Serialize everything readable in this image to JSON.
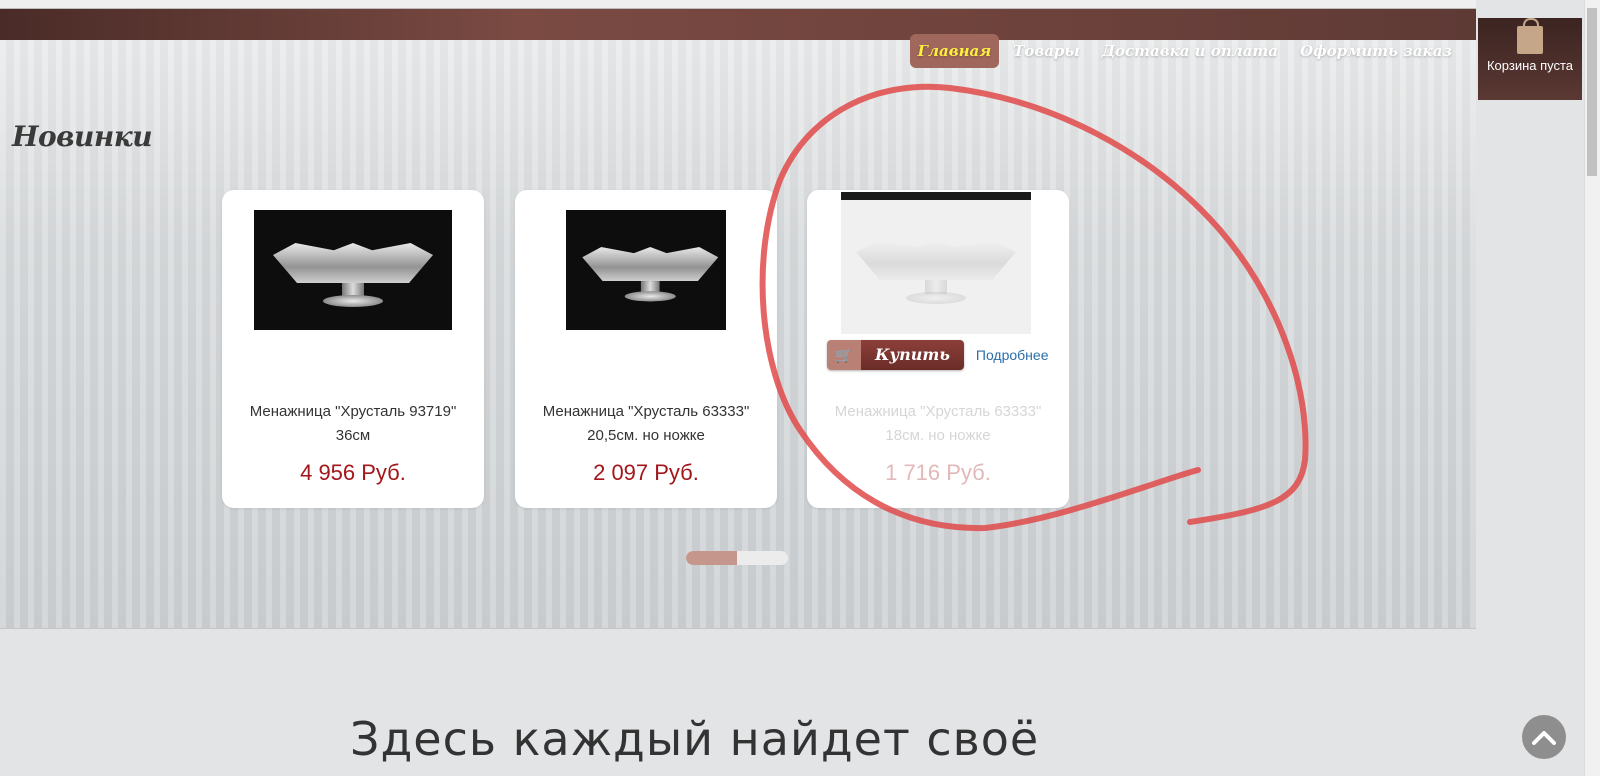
{
  "nav": {
    "items": [
      {
        "label": "Главная",
        "active": true
      },
      {
        "label": "Товары",
        "active": false
      },
      {
        "label": "Доставка и оплата",
        "active": false
      },
      {
        "label": "Оформить заказ",
        "active": false
      }
    ]
  },
  "cart": {
    "label": "Корзина пуста",
    "icon": "shopping-bag-icon"
  },
  "section": {
    "title": "Новинки"
  },
  "products": [
    {
      "name_line1": "Менажница \"Хрусталь 93719\"",
      "name_line2": "36см",
      "price": "4 956 Руб."
    },
    {
      "name_line1": "Менажница \"Хрусталь 63333\"",
      "name_line2": "20,5см. но ножке",
      "price": "2 097 Руб."
    },
    {
      "name_line1": "Менажница \"Хрусталь 63333\"",
      "name_line2": "18см. но ножке",
      "price": "1 716 Руб."
    }
  ],
  "buy": {
    "label": "Купить",
    "more": "Подробнее",
    "icon": "cart-icon"
  },
  "pager": {
    "pages": 2,
    "current": 1
  },
  "tagline": "Здесь каждый найдет своё",
  "colors": {
    "accent": "#a3161a",
    "nav_active_bg": "#a0675c",
    "nav_active_text": "#ffef40",
    "annotation": "#e04a4a"
  }
}
